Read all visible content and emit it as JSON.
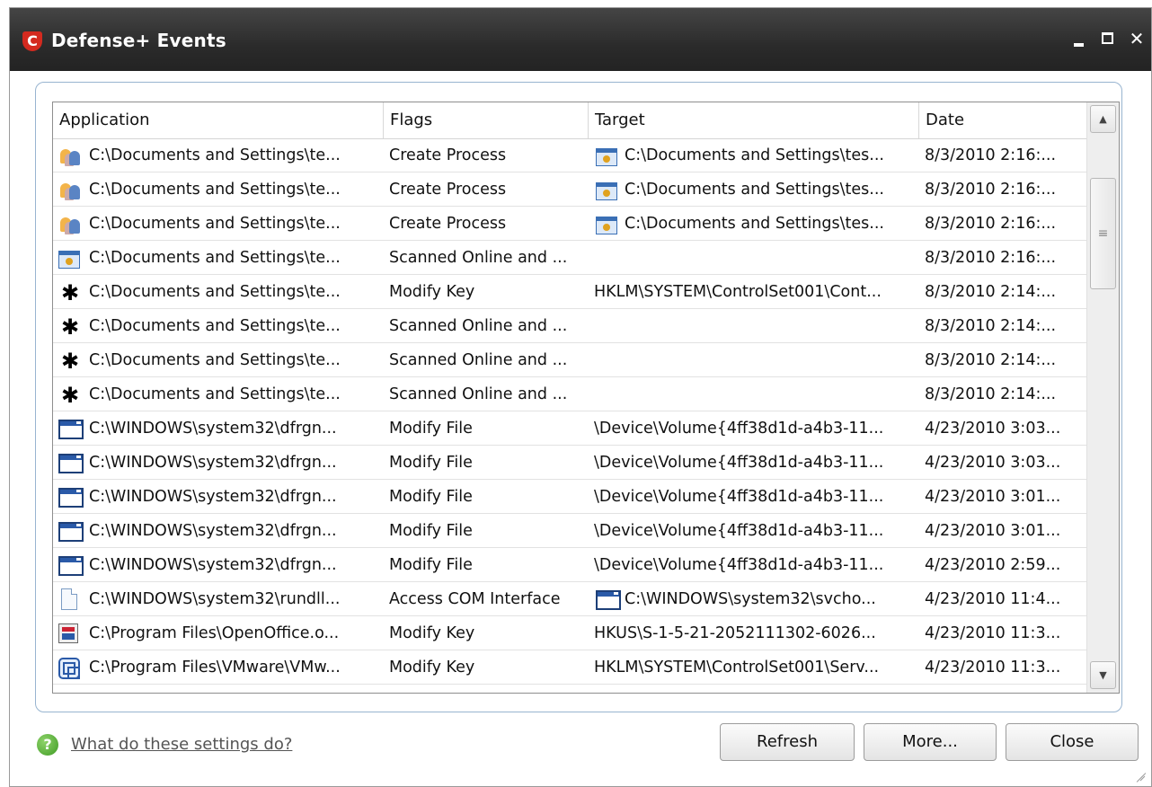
{
  "window": {
    "title": "Defense+ Events",
    "logo_glyph": "C",
    "close_glyph": "✕"
  },
  "columns": [
    "Application",
    "Flags",
    "Target",
    "Date"
  ],
  "rows": [
    {
      "icon": "people-icon",
      "app": "C:\\Documents and Settings\\te...",
      "flags": "Create Process",
      "target_icon": "app-window-icon",
      "target": "C:\\Documents and Settings\\tes...",
      "date": "8/3/2010 2:16:..."
    },
    {
      "icon": "people-icon",
      "app": "C:\\Documents and Settings\\te...",
      "flags": "Create Process",
      "target_icon": "app-window-icon",
      "target": "C:\\Documents and Settings\\tes...",
      "date": "8/3/2010 2:16:..."
    },
    {
      "icon": "people-icon",
      "app": "C:\\Documents and Settings\\te...",
      "flags": "Create Process",
      "target_icon": "app-window-icon",
      "target": "C:\\Documents and Settings\\tes...",
      "date": "8/3/2010 2:16:..."
    },
    {
      "icon": "app-window-icon",
      "app": "C:\\Documents and Settings\\te...",
      "flags": "Scanned Online and ...",
      "target_icon": "",
      "target": "",
      "date": "8/3/2010 2:16:..."
    },
    {
      "icon": "spider-icon",
      "app": "C:\\Documents and Settings\\te...",
      "flags": "Modify Key",
      "target_icon": "",
      "target": "HKLM\\SYSTEM\\ControlSet001\\Cont...",
      "date": "8/3/2010 2:14:..."
    },
    {
      "icon": "spider-icon",
      "app": "C:\\Documents and Settings\\te...",
      "flags": "Scanned Online and ...",
      "target_icon": "",
      "target": "",
      "date": "8/3/2010 2:14:..."
    },
    {
      "icon": "spider-icon",
      "app": "C:\\Documents and Settings\\te...",
      "flags": "Scanned Online and ...",
      "target_icon": "",
      "target": "",
      "date": "8/3/2010 2:14:..."
    },
    {
      "icon": "spider-icon",
      "app": "C:\\Documents and Settings\\te...",
      "flags": "Scanned Online and ...",
      "target_icon": "",
      "target": "",
      "date": "8/3/2010 2:14:..."
    },
    {
      "icon": "window-icon",
      "app": "C:\\WINDOWS\\system32\\dfrgn...",
      "flags": "Modify File",
      "target_icon": "",
      "target": "\\Device\\Volume{4ff38d1d-a4b3-11...",
      "date": "4/23/2010 3:03..."
    },
    {
      "icon": "window-icon",
      "app": "C:\\WINDOWS\\system32\\dfrgn...",
      "flags": "Modify File",
      "target_icon": "",
      "target": "\\Device\\Volume{4ff38d1d-a4b3-11...",
      "date": "4/23/2010 3:03..."
    },
    {
      "icon": "window-icon",
      "app": "C:\\WINDOWS\\system32\\dfrgn...",
      "flags": "Modify File",
      "target_icon": "",
      "target": "\\Device\\Volume{4ff38d1d-a4b3-11...",
      "date": "4/23/2010 3:01..."
    },
    {
      "icon": "window-icon",
      "app": "C:\\WINDOWS\\system32\\dfrgn...",
      "flags": "Modify File",
      "target_icon": "",
      "target": "\\Device\\Volume{4ff38d1d-a4b3-11...",
      "date": "4/23/2010 3:01..."
    },
    {
      "icon": "window-icon",
      "app": "C:\\WINDOWS\\system32\\dfrgn...",
      "flags": "Modify File",
      "target_icon": "",
      "target": "\\Device\\Volume{4ff38d1d-a4b3-11...",
      "date": "4/23/2010 2:59..."
    },
    {
      "icon": "document-icon",
      "app": "C:\\WINDOWS\\system32\\rundll...",
      "flags": "Access COM Interface",
      "target_icon": "window-icon",
      "target": "C:\\WINDOWS\\system32\\svcho...",
      "date": "4/23/2010 11:4..."
    },
    {
      "icon": "openoffice-icon",
      "app": "C:\\Program Files\\OpenOffice.o...",
      "flags": "Modify Key",
      "target_icon": "",
      "target": "HKUS\\S-1-5-21-2052111302-6026...",
      "date": "4/23/2010 11:3..."
    },
    {
      "icon": "vmware-icon",
      "app": "C:\\Program Files\\VMware\\VMw...",
      "flags": "Modify Key",
      "target_icon": "",
      "target": "HKLM\\SYSTEM\\ControlSet001\\Serv...",
      "date": "4/23/2010 11:3..."
    }
  ],
  "help": {
    "link": "What do these settings do?",
    "icon_glyph": "?"
  },
  "buttons": {
    "refresh": "Refresh",
    "more": "More...",
    "close": "Close"
  },
  "scrollbar": {
    "up_glyph": "▲",
    "down_glyph": "▼",
    "thumb_glyph": "≡"
  },
  "colors": {
    "titlebar": "#2f2f2f",
    "frame_border": "#98b4d0",
    "logo": "#d42a1f"
  }
}
